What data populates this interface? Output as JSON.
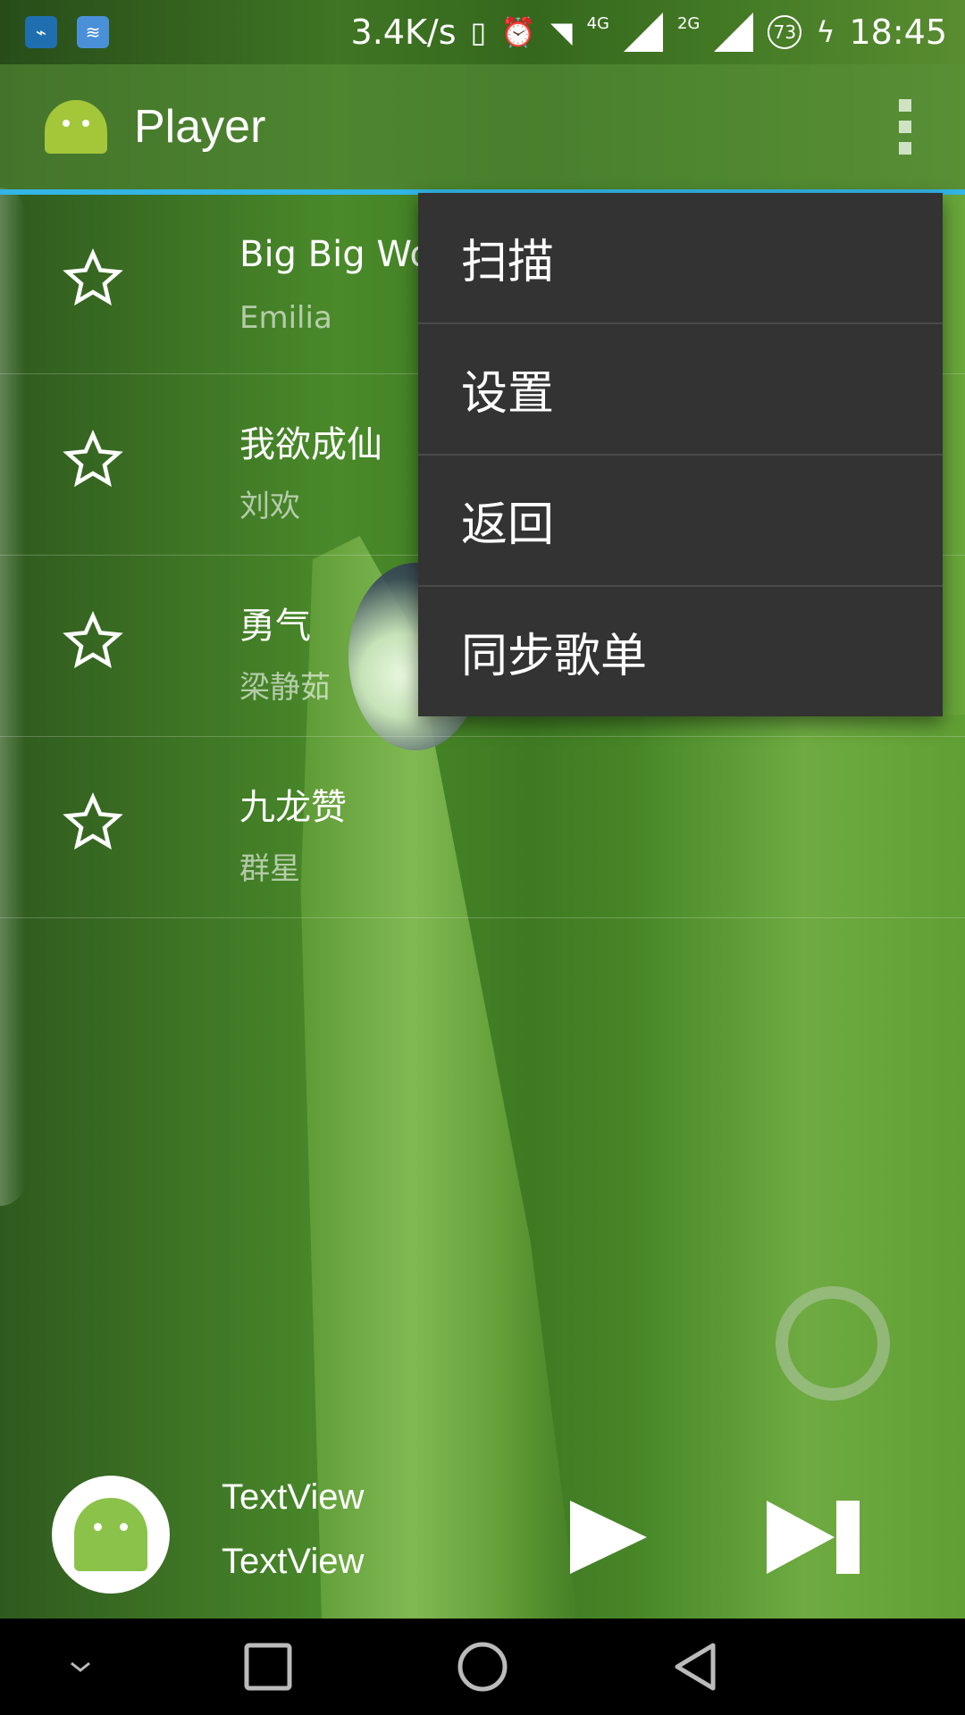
{
  "status_bar": {
    "network_speed": "3.4K/s",
    "label_4g": "4G",
    "label_2g": "2G",
    "battery": "73",
    "time": "18:45",
    "icons": [
      "usb-icon",
      "wifi-share-icon",
      "vibrate-icon",
      "alarm-icon",
      "wifi-icon",
      "signal-icon",
      "battery-charging-icon"
    ]
  },
  "app_bar": {
    "title": "Player",
    "overflow_icon": "more-vert-icon"
  },
  "songs": [
    {
      "title": "Big Big Wo",
      "artist": "Emilia"
    },
    {
      "title": "我欲成仙",
      "artist": "刘欢"
    },
    {
      "title": "勇气",
      "artist": "梁静茹"
    },
    {
      "title": "九龙赞",
      "artist": "群星"
    }
  ],
  "menu": {
    "items": [
      "扫描",
      "设置",
      "返回",
      "同步歌单"
    ]
  },
  "player": {
    "title": "TextView",
    "subtitle": "TextView"
  },
  "colors": {
    "accent": "#33b5e5",
    "menu_bg": "#333333",
    "nav_bg": "#000000"
  }
}
